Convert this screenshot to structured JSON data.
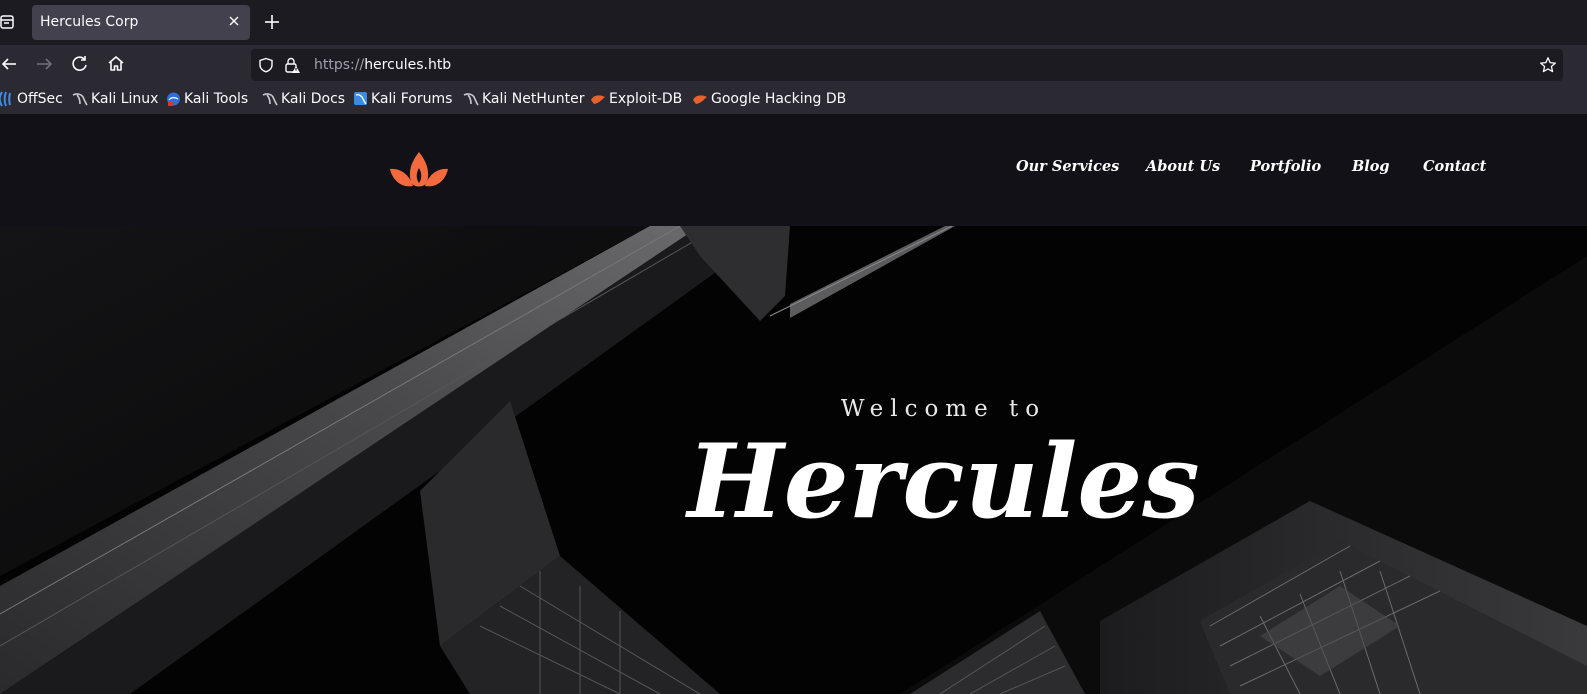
{
  "browser": {
    "tab": {
      "title": "Hercules Corp"
    },
    "url": {
      "scheme": "https://",
      "host": "hercules.htb"
    },
    "bookmarks": [
      {
        "label": "OffSec",
        "icon": "offsec-icon"
      },
      {
        "label": "Kali Linux",
        "icon": "kali-dragon-icon"
      },
      {
        "label": "Kali Tools",
        "icon": "kali-tools-icon"
      },
      {
        "label": "Kali Docs",
        "icon": "kali-dragon-icon"
      },
      {
        "label": "Kali Forums",
        "icon": "kali-forums-icon"
      },
      {
        "label": "Kali NetHunter",
        "icon": "kali-dragon-icon"
      },
      {
        "label": "Exploit-DB",
        "icon": "exploit-db-icon"
      },
      {
        "label": "Google Hacking DB",
        "icon": "exploit-db-icon"
      }
    ]
  },
  "site": {
    "logo": "lotus-flame-icon",
    "accent_color": "#f26a3d",
    "nav": [
      "Our Services",
      "About Us",
      "Portfolio",
      "Blog",
      "Contact"
    ],
    "hero": {
      "kicker": "Welcome to",
      "title": "Hercules"
    }
  }
}
